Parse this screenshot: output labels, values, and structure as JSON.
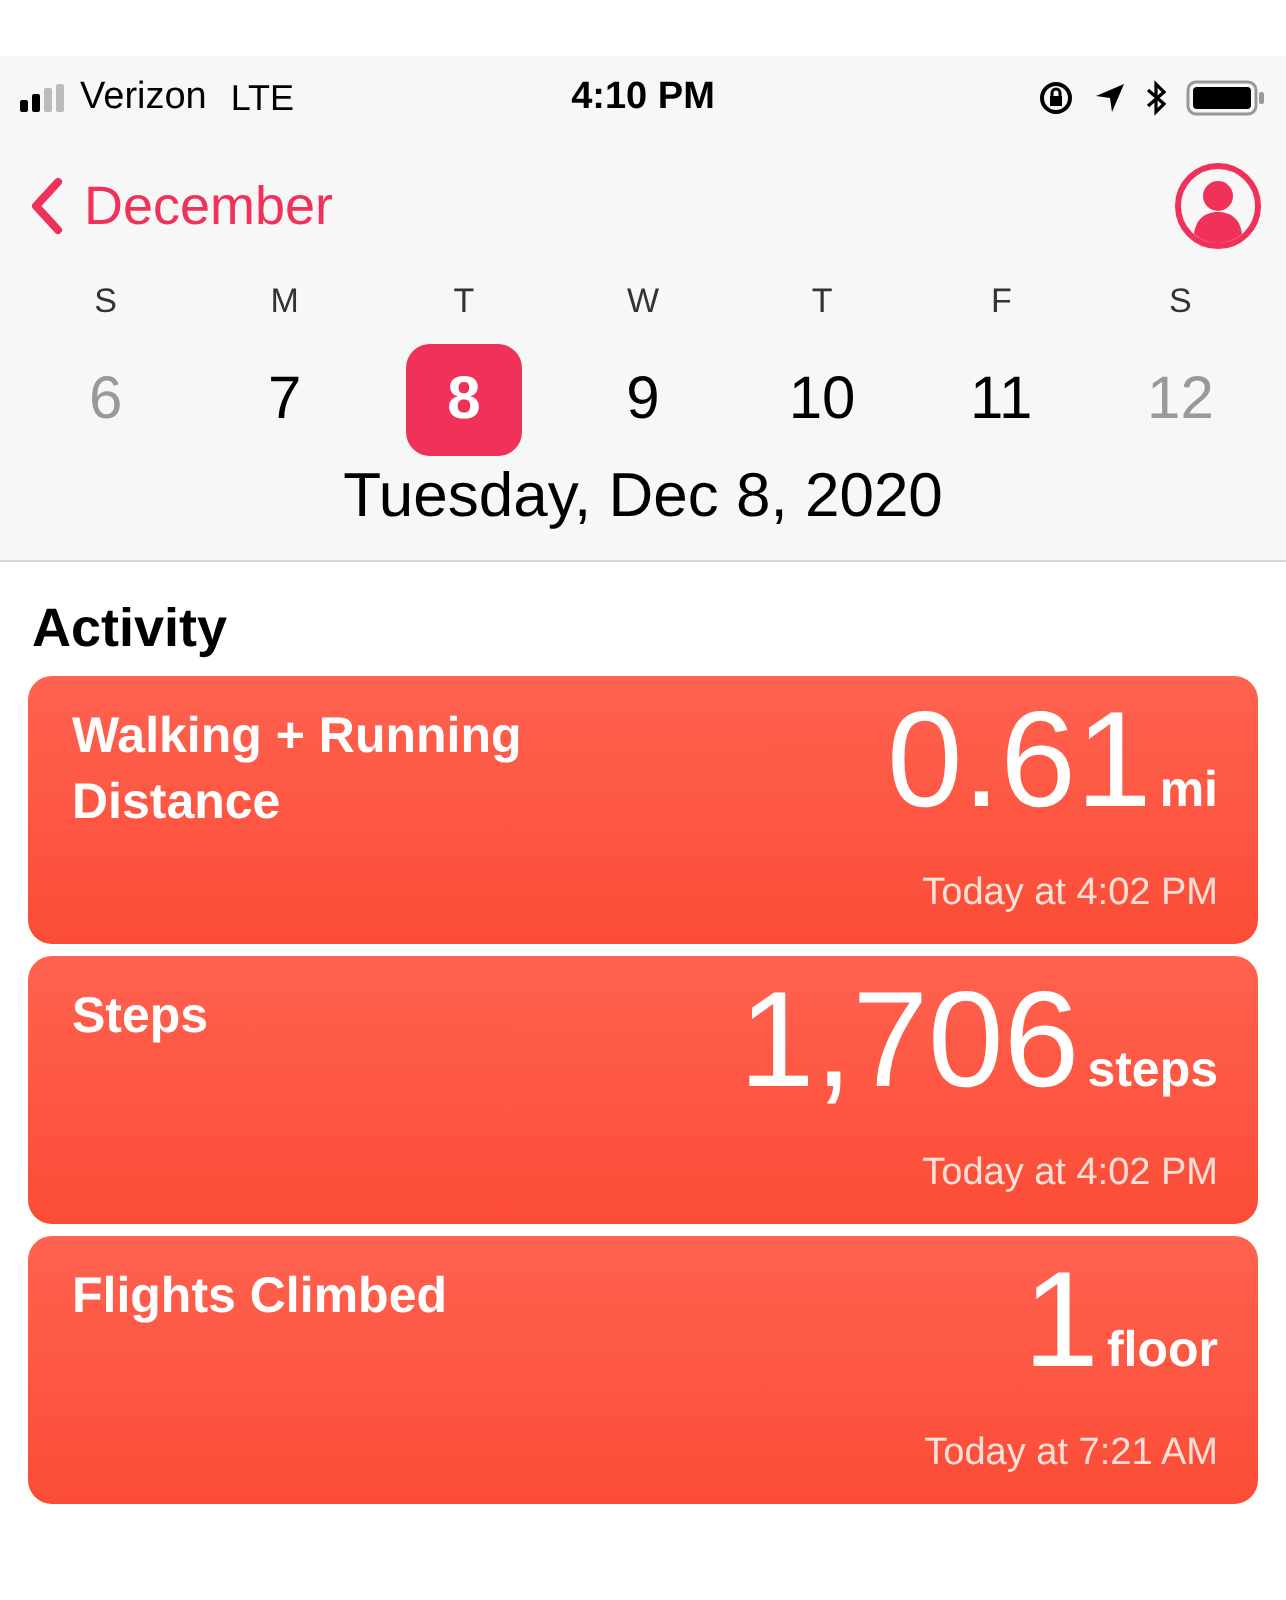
{
  "status_bar": {
    "carrier": "Verizon",
    "network": "LTE",
    "time": "4:10 PM"
  },
  "nav": {
    "back_label": "December"
  },
  "week": [
    {
      "letter": "S",
      "date": "6",
      "dimmed": true,
      "selected": false
    },
    {
      "letter": "M",
      "date": "7",
      "dimmed": false,
      "selected": false
    },
    {
      "letter": "T",
      "date": "8",
      "dimmed": false,
      "selected": true
    },
    {
      "letter": "W",
      "date": "9",
      "dimmed": false,
      "selected": false
    },
    {
      "letter": "T",
      "date": "10",
      "dimmed": false,
      "selected": false
    },
    {
      "letter": "F",
      "date": "11",
      "dimmed": false,
      "selected": false
    },
    {
      "letter": "S",
      "date": "12",
      "dimmed": true,
      "selected": false
    }
  ],
  "selected_date": "Tuesday, Dec 8, 2020",
  "section_title": "Activity",
  "cards": [
    {
      "title": "Walking + Running Distance",
      "value": "0.61",
      "unit": "mi",
      "time": "Today at 4:02 PM"
    },
    {
      "title": "Steps",
      "value": "1,706",
      "unit": "steps",
      "time": "Today at 4:02 PM"
    },
    {
      "title": "Flights Climbed",
      "value": "1",
      "unit": "floor",
      "time": "Today at 7:21 AM"
    }
  ]
}
